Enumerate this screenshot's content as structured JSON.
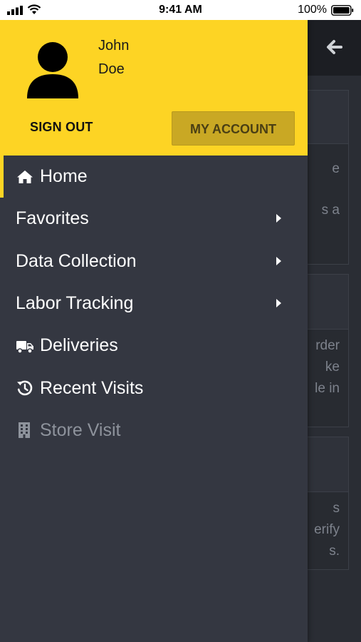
{
  "status_bar": {
    "time": "9:41 AM",
    "battery_percent": "100%"
  },
  "user": {
    "first_name": "John",
    "last_name": "Doe"
  },
  "drawer": {
    "sign_out_label": "SIGN OUT",
    "my_account_label": "MY ACCOUNT",
    "accent_color": "#fdd424",
    "items": [
      {
        "label": "Home",
        "icon": "home-icon",
        "active": true
      },
      {
        "label": "Favorites",
        "icon": null,
        "submenu": true
      },
      {
        "label": "Data Collection",
        "icon": null,
        "submenu": true
      },
      {
        "label": "Labor Tracking",
        "icon": null,
        "submenu": true
      },
      {
        "label": "Deliveries",
        "icon": "truck-icon"
      },
      {
        "label": "Recent Visits",
        "icon": "history-icon"
      },
      {
        "label": "Store Visit",
        "icon": "building-icon",
        "disabled": true
      }
    ]
  },
  "background": {
    "card1_lines": [
      "e",
      "s a"
    ],
    "card2_lines": [
      "rder",
      "ke",
      "le in"
    ],
    "card3_lines": [
      "s",
      "erify",
      "s."
    ]
  }
}
